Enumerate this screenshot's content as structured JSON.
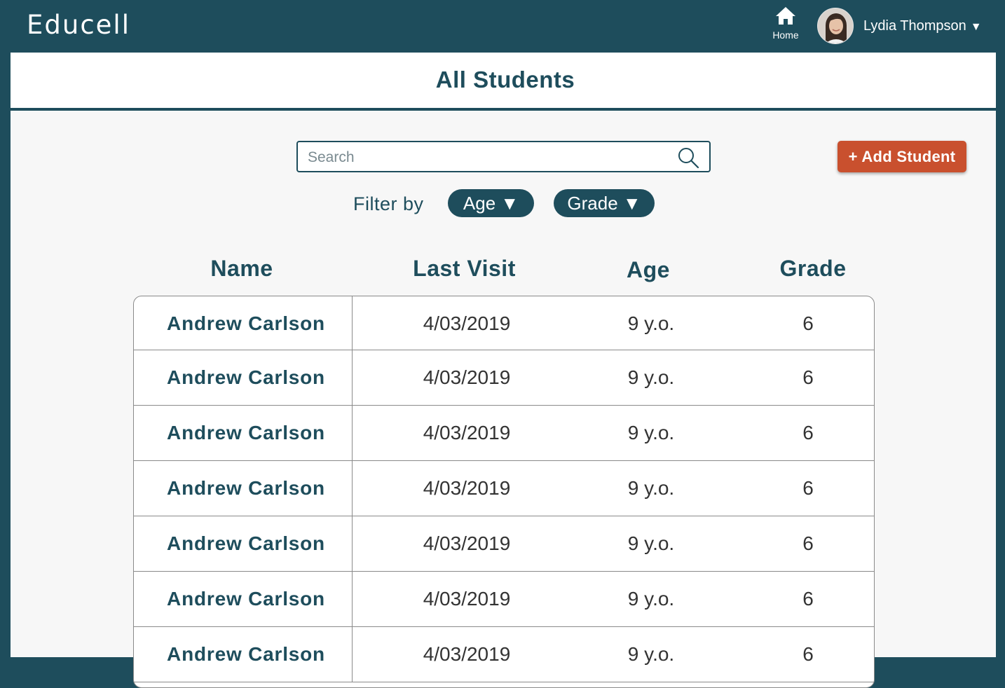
{
  "app": {
    "logo": "Educell",
    "home_label": "Home",
    "user_name": "Lydia Thompson",
    "user_caret": "▼"
  },
  "page": {
    "title": "All Students"
  },
  "search": {
    "placeholder": "Search",
    "value": ""
  },
  "actions": {
    "add_student_label": "+ Add Student"
  },
  "filters": {
    "label": "Filter by",
    "age_label": "Age ▼",
    "grade_label": "Grade ▼"
  },
  "table": {
    "columns": [
      "Name",
      "Last Visit",
      "Age",
      "Grade"
    ],
    "rows": [
      {
        "name": "Andrew Carlson",
        "last_visit": "4/03/2019",
        "age": "9 y.o.",
        "grade": "6"
      },
      {
        "name": "Andrew Carlson",
        "last_visit": "4/03/2019",
        "age": "9 y.o.",
        "grade": "6"
      },
      {
        "name": "Andrew Carlson",
        "last_visit": "4/03/2019",
        "age": "9 y.o.",
        "grade": "6"
      },
      {
        "name": "Andrew Carlson",
        "last_visit": "4/03/2019",
        "age": "9 y.o.",
        "grade": "6"
      },
      {
        "name": "Andrew Carlson",
        "last_visit": "4/03/2019",
        "age": "9 y.o.",
        "grade": "6"
      },
      {
        "name": "Andrew Carlson",
        "last_visit": "4/03/2019",
        "age": "9 y.o.",
        "grade": "6"
      },
      {
        "name": "Andrew Carlson",
        "last_visit": "4/03/2019",
        "age": "9 y.o.",
        "grade": "6"
      }
    ]
  },
  "colors": {
    "primary": "#1e4d5c",
    "accent": "#c9502e",
    "panel_bg": "#f7f7f7"
  },
  "icons": {
    "home": "home-icon",
    "search": "search-icon",
    "avatar": "user-avatar"
  }
}
